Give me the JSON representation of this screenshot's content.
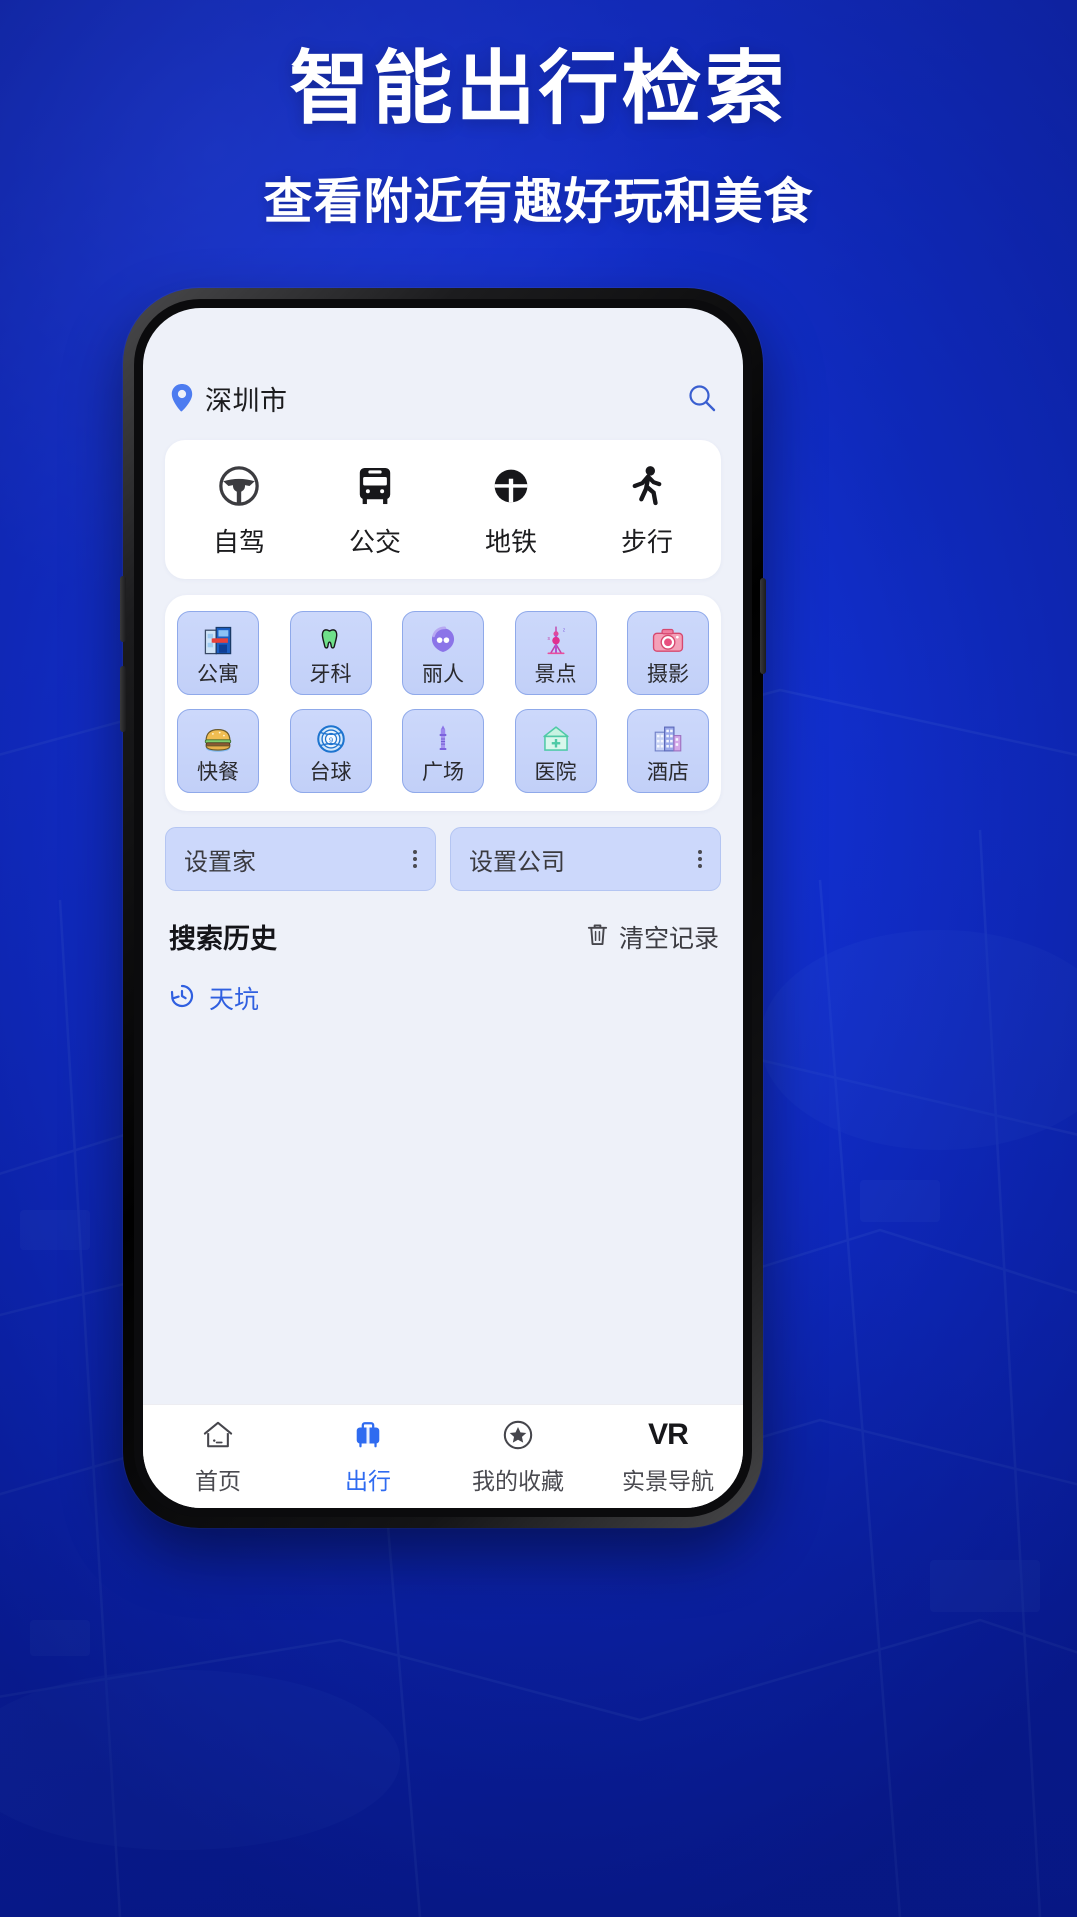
{
  "hero": {
    "title": "智能出行检索",
    "subtitle": "查看附近有趣好玩和美食"
  },
  "colors": {
    "background_blue": "#1433e8",
    "accent_blue": "#2f6bf0",
    "pin_blue": "#4d7cf0",
    "screen_bg": "#eef1f9",
    "card_white": "#ffffff",
    "tile_fill": "#ccd8fb",
    "tile_border": "#8fa9ea"
  },
  "app": {
    "location": {
      "icon": "location-pin-icon",
      "city": "深圳市",
      "search_icon": "search-icon"
    },
    "transport_modes": [
      {
        "icon": "steering-wheel-icon",
        "label": "自驾"
      },
      {
        "icon": "bus-icon",
        "label": "公交"
      },
      {
        "icon": "metro-icon",
        "label": "地铁"
      },
      {
        "icon": "walking-icon",
        "label": "步行"
      }
    ],
    "categories": [
      [
        {
          "icon": "apartment-icon",
          "label": "公寓"
        },
        {
          "icon": "tooth-icon",
          "label": "牙科"
        },
        {
          "icon": "beauty-icon",
          "label": "丽人"
        },
        {
          "icon": "tower-icon",
          "label": "景点"
        },
        {
          "icon": "camera-icon",
          "label": "摄影"
        }
      ],
      [
        {
          "icon": "burger-icon",
          "label": "快餐"
        },
        {
          "icon": "billiards-icon",
          "label": "台球"
        },
        {
          "icon": "plaza-icon",
          "label": "广场"
        },
        {
          "icon": "hospital-icon",
          "label": "医院"
        },
        {
          "icon": "hotel-icon",
          "label": "酒店"
        }
      ]
    ],
    "setters": [
      {
        "label": "设置家",
        "menu_icon": "more-vertical-icon"
      },
      {
        "label": "设置公司",
        "menu_icon": "more-vertical-icon"
      }
    ],
    "history": {
      "title": "搜索历史",
      "clear_icon": "trash-icon",
      "clear_label": "清空记录",
      "items": [
        {
          "icon": "history-clock-icon",
          "label": "天坑"
        }
      ]
    },
    "tabbar": [
      {
        "icon": "home-icon",
        "label": "首页",
        "active": false
      },
      {
        "icon": "travel-bag-icon",
        "label": "出行",
        "active": true
      },
      {
        "icon": "star-circle-icon",
        "label": "我的收藏",
        "active": false
      },
      {
        "icon": "vr-icon",
        "label": "实景导航",
        "active": false,
        "glyph": "VR"
      }
    ]
  }
}
